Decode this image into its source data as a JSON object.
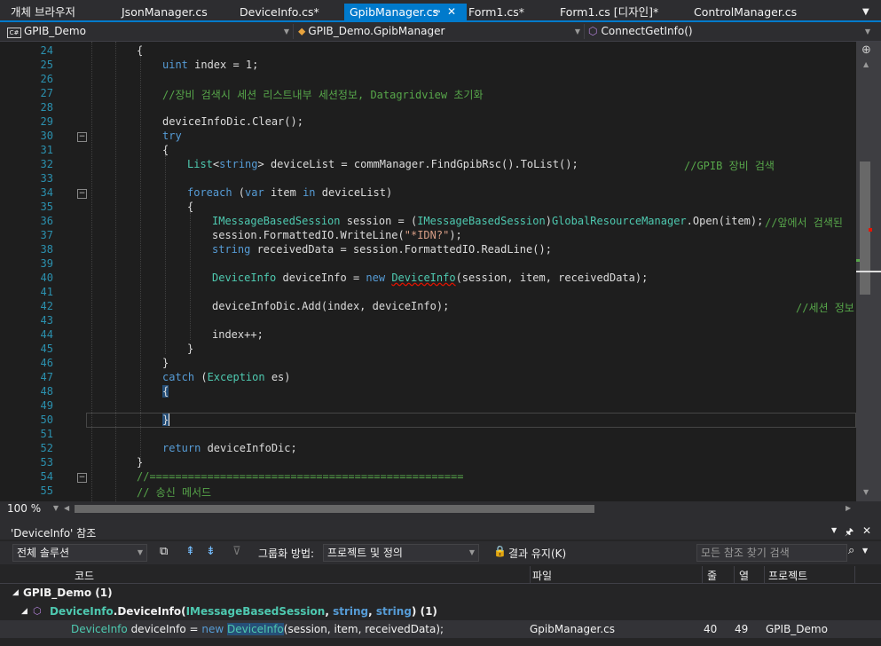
{
  "tabs": [
    {
      "label": "개체 브라우저"
    },
    {
      "label": "JsonManager.cs"
    },
    {
      "label": "DeviceInfo.cs*"
    },
    {
      "label": "GpibManager.cs"
    },
    {
      "label": "Form1.cs*"
    },
    {
      "label": "Form1.cs [디자인]*"
    },
    {
      "label": "ControlManager.cs"
    }
  ],
  "nav": {
    "project": "GPIB_Demo",
    "class": "GPIB_Demo.GpibManager",
    "member": "ConnectGetInfo()"
  },
  "code_lines": [
    {
      "n": "24"
    },
    {
      "n": "25"
    },
    {
      "n": "26"
    },
    {
      "n": "27"
    },
    {
      "n": "28"
    },
    {
      "n": "29"
    },
    {
      "n": "30"
    },
    {
      "n": "31"
    },
    {
      "n": "32"
    },
    {
      "n": "33"
    },
    {
      "n": "34"
    },
    {
      "n": "35"
    },
    {
      "n": "36"
    },
    {
      "n": "37"
    },
    {
      "n": "38"
    },
    {
      "n": "39"
    },
    {
      "n": "40"
    },
    {
      "n": "41"
    },
    {
      "n": "42"
    },
    {
      "n": "43"
    },
    {
      "n": "44"
    },
    {
      "n": "45"
    },
    {
      "n": "46"
    },
    {
      "n": "47"
    },
    {
      "n": "48"
    },
    {
      "n": "49"
    },
    {
      "n": "50"
    },
    {
      "n": "51"
    },
    {
      "n": "52"
    },
    {
      "n": "53"
    },
    {
      "n": "54"
    },
    {
      "n": "55"
    }
  ],
  "code": {
    "l24": "{",
    "l25_kw": "uint",
    "l25_rest": " index = 1;",
    "l27": "//장비 검색시 세션 리스트내부 세션정보, Datagridview 초기화",
    "l29": "deviceInfoDic.Clear();",
    "l30": "try",
    "l31": "{",
    "l32_ty": "List",
    "l32_a": "<",
    "l32_kw": "string",
    "l32_b": "> deviceList = commManager.FindGpibRsc().ToList();",
    "l32_cm": "//GPIB 장비 검색",
    "l34_kw": "foreach",
    "l34_a": " (",
    "l34_kw2": "var",
    "l34_b": " item ",
    "l34_kw3": "in",
    "l34_c": " deviceList)",
    "l35": "{",
    "l36_ty": "IMessageBasedSession",
    "l36_a": " session = (",
    "l36_ty2": "IMessageBasedSession",
    "l36_b": ")",
    "l36_ty3": "GlobalResourceManager",
    "l36_c": ".Open(item);",
    "l36_cm": "//앞에서 검색된",
    "l37_a": "session.FormattedIO.WriteLine(",
    "l37_st": "\"*IDN?\"",
    "l37_b": ");",
    "l38_kw": "string",
    "l38_a": " receivedData = session.FormattedIO.ReadLine();",
    "l40_ty": "DeviceInfo",
    "l40_a": " deviceInfo = ",
    "l40_kw": "new",
    "l40_ty2": "DeviceInfo",
    "l40_b": "(session, item, receivedData);",
    "l42_a": "deviceInfoDic.Add(index, deviceInfo);",
    "l42_cm": "//세션 정보",
    "l44": "index++;",
    "l45": "}",
    "l46": "}",
    "l47_kw": "catch",
    "l47_a": " (",
    "l47_ty": "Exception",
    "l47_b": " es)",
    "l48": "{",
    "l50": "}",
    "l52_kw": "return",
    "l52_a": " deviceInfoDic;",
    "l53": "}",
    "l54": "//=================================================",
    "l55": "// 송신 메서드"
  },
  "zoom": "100 %",
  "refs": {
    "title": "'DeviceInfo' 참조",
    "scope": "전체 솔루션",
    "group_label": "그룹화 방법:",
    "group_value": "프로젝트 및 정의",
    "keep_results": "결과 유지(K)",
    "search_placeholder": "모든 참조 찾기 검색",
    "columns": {
      "code": "코드",
      "file": "파일",
      "line": "줄",
      "col": "열",
      "project": "프로젝트"
    },
    "group1": "GPIB_Demo (1)",
    "group2_name": "DeviceInfo",
    "group2_dot": ".",
    "group2_ctor": "DeviceInfo",
    "group2_paren": "(",
    "group2_param1": "IMessageBasedSession",
    "group2_sep1": ", ",
    "group2_param2": "string",
    "group2_sep2": ", ",
    "group2_param3": "string",
    "group2_end": ") (1)",
    "result": {
      "c1": "DeviceInfo",
      "c2": " deviceInfo = ",
      "c3": "new",
      "c4": " ",
      "c5": "DeviceInfo",
      "c6": "(session, item, receivedData);",
      "file": "GpibManager.cs",
      "line": "40",
      "col": "49",
      "project": "GPIB_Demo"
    }
  },
  "colors": {
    "accent": "#007acc",
    "keyword": "#569cd6",
    "type": "#4ec9b0",
    "comment": "#57a64a",
    "string": "#d69d85",
    "linenum": "#2b91af"
  }
}
